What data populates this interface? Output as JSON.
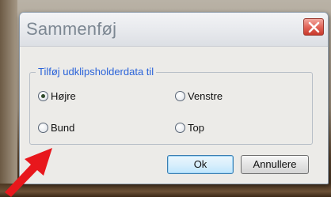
{
  "dialog": {
    "title": "Sammenføj",
    "group_label": "Tilføj udklipsholderdata til",
    "options": [
      {
        "label": "Højre",
        "selected": true
      },
      {
        "label": "Venstre",
        "selected": false
      },
      {
        "label": "Bund",
        "selected": false
      },
      {
        "label": "Top",
        "selected": false
      }
    ],
    "buttons": {
      "ok": "Ok",
      "cancel": "Annullere"
    }
  },
  "annotation": {
    "arrow_color": "#e8171c",
    "icon": "arrow-pointer-icon"
  }
}
